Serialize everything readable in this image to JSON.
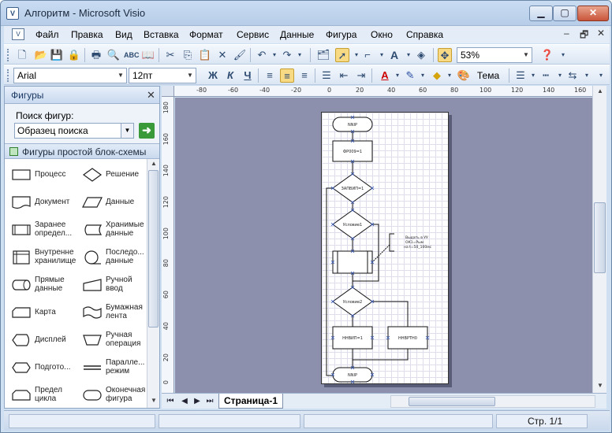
{
  "window": {
    "title": "Алгоритм - Microsoft Visio",
    "minimize": "▁",
    "maximize": "▢",
    "close": "✕"
  },
  "menu": {
    "items": [
      "Файл",
      "Правка",
      "Вид",
      "Вставка",
      "Формат",
      "Сервис",
      "Данные",
      "Фигура",
      "Окно",
      "Справка"
    ],
    "doc_min": "–",
    "doc_restore": "🗗",
    "doc_close": "✕"
  },
  "toolbar1": {
    "zoom": "53%"
  },
  "toolbar2": {
    "font": "Arial",
    "size": "12пт",
    "bold": "Ж",
    "italic": "К",
    "underline": "Ч",
    "theme": "Тема",
    "text_color_letter": "A"
  },
  "shapes_pane": {
    "title": "Фигуры",
    "search_label": "Поиск фигур:",
    "search_value": "Образец поиска",
    "stencil_title": "Фигуры простой блок-схемы",
    "shapes": [
      "Процесс",
      "Решение",
      "Документ",
      "Данные",
      "Заранее определ...",
      "Хранимые данные",
      "Внутренне хранилище",
      "Последо... данные",
      "Прямые данные",
      "Ручной ввод",
      "Карта",
      "Бумажная лента",
      "Дисплей",
      "Ручная операция",
      "Подгото...",
      "Паралле... режим",
      "Предел цикла",
      "Оконечная фигура"
    ]
  },
  "ruler_top": [
    "-80",
    "-60",
    "-40",
    "-20",
    "0",
    "20",
    "40",
    "60",
    "80",
    "100",
    "120",
    "140",
    "160"
  ],
  "ruler_left": [
    "180",
    "160",
    "140",
    "120",
    "100",
    "80",
    "60",
    "40",
    "20",
    "0"
  ],
  "diagram": {
    "nodes": [
      "NNIP",
      "ФР009=1",
      "ЗАПВИП=1",
      "Условие1",
      "Условие2",
      "ННВИП=1",
      "ННВРТН0",
      "NNIP"
    ],
    "comment": [
      "Выдать в УУ",
      "ОК1=Рым",
      "на t=50_100мс"
    ]
  },
  "tabs": {
    "page": "Страница-1"
  },
  "status": {
    "page_info": "Стр. 1/1"
  }
}
